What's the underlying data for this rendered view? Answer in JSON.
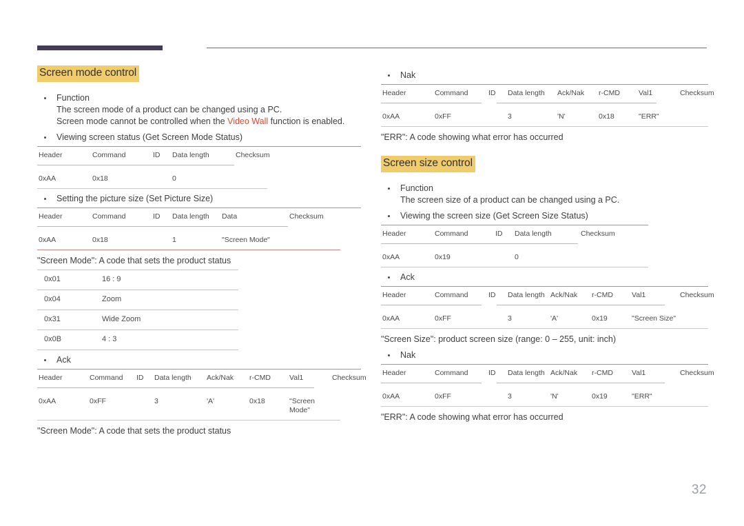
{
  "page": {
    "number": "32"
  },
  "left_column": {
    "heading": "Screen mode control",
    "function_label": "Function",
    "function_line1": "The screen mode of a product can be changed using a PC.",
    "function_line2_pre": "Screen mode cannot be controlled when the ",
    "function_line2_accent": "Video Wall",
    "function_line2_post": " function is enabled.",
    "get_status_label": "Viewing screen status (Get Screen Mode Status)",
    "get_status_table": {
      "headers": [
        "Header",
        "Command",
        "ID",
        "Data length",
        "Checksum"
      ],
      "row": [
        "0xAA",
        "0x18",
        "",
        "0",
        ""
      ]
    },
    "set_size_label": "Setting the picture size (Set Picture Size)",
    "set_size_table": {
      "headers": [
        "Header",
        "Command",
        "ID",
        "Data length",
        "Data",
        "Checksum"
      ],
      "row": [
        "0xAA",
        "0x18",
        "",
        "1",
        "\"Screen Mode\"",
        ""
      ]
    },
    "screen_mode_caption": "\"Screen Mode\": A code that sets the product status",
    "screen_mode_codes": [
      {
        "code": "0x01",
        "value": "16 : 9"
      },
      {
        "code": "0x04",
        "value": "Zoom"
      },
      {
        "code": "0x31",
        "value": "Wide Zoom"
      },
      {
        "code": "0x0B",
        "value": "4 : 3"
      }
    ],
    "ack_label": "Ack",
    "ack_table": {
      "headers": [
        "Header",
        "Command",
        "ID",
        "Data length",
        "Ack/Nak",
        "r-CMD",
        "Val1",
        "Checksum"
      ],
      "row": [
        "0xAA",
        "0xFF",
        "",
        "3",
        "'A'",
        "0x18",
        "\"Screen Mode\"",
        ""
      ]
    },
    "ack_caption": "\"Screen Mode\": A code that sets the product status"
  },
  "right_column": {
    "nak_label": "Nak",
    "nak_table": {
      "headers": [
        "Header",
        "Command",
        "ID",
        "Data length",
        "Ack/Nak",
        "r-CMD",
        "Val1",
        "Checksum"
      ],
      "row": [
        "0xAA",
        "0xFF",
        "",
        "3",
        "'N'",
        "0x18",
        "\"ERR\"",
        ""
      ]
    },
    "nak_caption": "\"ERR\": A code showing what error has occurred",
    "heading": "Screen size control",
    "function_label": "Function",
    "function_line1": "The screen size of a product can be changed using a PC.",
    "get_status_label": "Viewing the screen size (Get Screen Size Status)",
    "get_status_table": {
      "headers": [
        "Header",
        "Command",
        "ID",
        "Data length",
        "Checksum"
      ],
      "row": [
        "0xAA",
        "0x19",
        "",
        "0",
        ""
      ]
    },
    "ack_label": "Ack",
    "ack_table": {
      "headers": [
        "Header",
        "Command",
        "ID",
        "Data length",
        "Ack/Nak",
        "r-CMD",
        "Val1",
        "Checksum"
      ],
      "row": [
        "0xAA",
        "0xFF",
        "",
        "3",
        "'A'",
        "0x19",
        "\"Screen Size\"",
        ""
      ]
    },
    "ack_caption": "\"Screen Size\": product screen size (range: 0 – 255, unit: inch)",
    "nak2_label": "Nak",
    "nak2_table": {
      "headers": [
        "Header",
        "Command",
        "ID",
        "Data length",
        "Ack/Nak",
        "r-CMD",
        "Val1",
        "Checksum"
      ],
      "row": [
        "0xAA",
        "0xFF",
        "",
        "3",
        "'N'",
        "0x19",
        "\"ERR\"",
        ""
      ]
    },
    "nak2_caption": "\"ERR\": A code showing what error has occurred"
  }
}
